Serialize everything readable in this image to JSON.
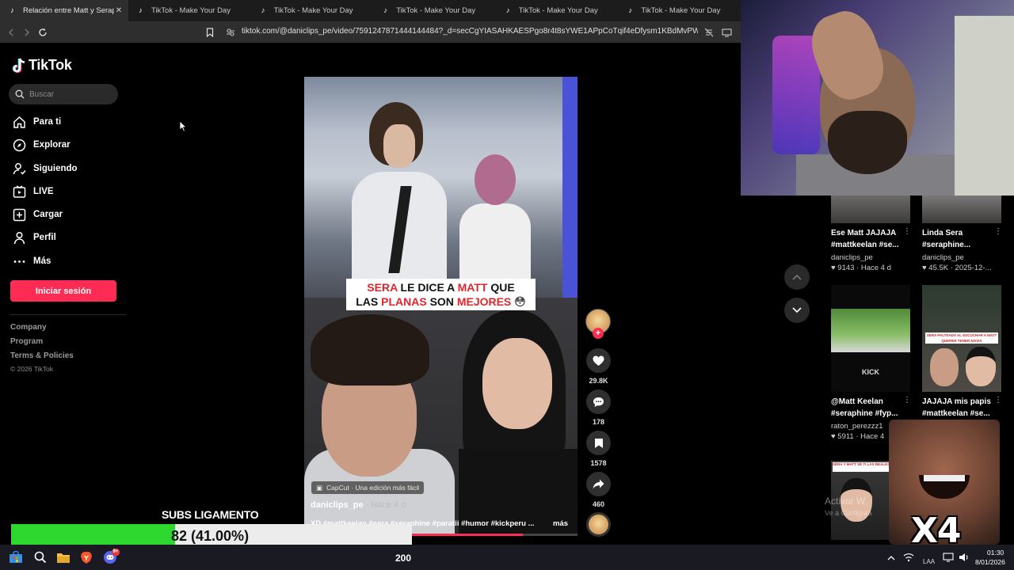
{
  "browser": {
    "tabs": [
      {
        "label": "Relación entre Matt y Seraph",
        "active": true
      },
      {
        "label": "TikTok - Make Your Day",
        "active": false
      },
      {
        "label": "TikTok - Make Your Day",
        "active": false
      },
      {
        "label": "TikTok - Make Your Day",
        "active": false
      },
      {
        "label": "TikTok - Make Your Day",
        "active": false
      },
      {
        "label": "TikTok - Make Your Day",
        "active": false
      }
    ],
    "url": "tiktok.com/@daniclips_pe/video/7591247871444144484?_d=secCgYIASAHKAESPgo8r4t8sYWE1APpCoTqif4eDfysm1KBdMvPWyLx51GZrZu..."
  },
  "sidebar": {
    "logo": "TikTok",
    "search_placeholder": "Buscar",
    "nav": [
      {
        "label": "Para ti",
        "icon": "home-icon"
      },
      {
        "label": "Explorar",
        "icon": "compass-icon"
      },
      {
        "label": "Siguiendo",
        "icon": "following-icon"
      },
      {
        "label": "LIVE",
        "icon": "live-icon"
      },
      {
        "label": "Cargar",
        "icon": "upload-icon"
      },
      {
        "label": "Perfil",
        "icon": "profile-icon"
      },
      {
        "label": "Más",
        "icon": "more-icon"
      }
    ],
    "login_label": "Iniciar sesión",
    "footer_links": [
      "Company",
      "Program",
      "Terms & Policies"
    ],
    "copyright": "© 2026 TikTok"
  },
  "video": {
    "caption": {
      "line1": [
        {
          "t": "SERA",
          "red": true
        },
        {
          "t": " LE DICE A ",
          "red": false
        },
        {
          "t": "MATT",
          "red": true
        },
        {
          "t": " QUE",
          "red": false
        }
      ],
      "line2": [
        {
          "t": "LAS ",
          "red": false
        },
        {
          "t": "PLANAS",
          "red": true
        },
        {
          "t": " SON ",
          "red": false
        },
        {
          "t": "MEJORES",
          "red": true
        },
        {
          "t": " 😳",
          "red": false
        }
      ]
    },
    "capcut_label": "CapCut · Una edición más fácil",
    "author": "daniclips_pe",
    "time": " · Hace 4 d",
    "description": "XD #mattkeelan #sera #seraphine #paratii #humor #kickperu ...",
    "more_label": "más",
    "progress": 0.8
  },
  "actions": {
    "likes": "29.8K",
    "comments": "178",
    "saves": "1578",
    "shares": "460"
  },
  "recommendations": [
    {
      "title": "Ese Matt JAJAJA #mattkeelan #se...",
      "author": "daniclips_pe",
      "stats": "♥ 9143 · Hace 4 d"
    },
    {
      "title": "Linda Sera #seraphine...",
      "author": "daniclips_pe",
      "stats": "♥ 45.5K · 2025-12-..."
    },
    {
      "title": "@Matt Keelan #seraphine #fyp...",
      "author": "raton_perezzz1",
      "stats": "♥ 5911 · Hace 4"
    },
    {
      "title": "JAJAJA mis papis #mattkeelan #se...",
      "author": "",
      "stats": ""
    }
  ],
  "thumb_texts": {
    "kick": "KICK",
    "sera_thumb": "SERA PALTEADA AL ESCUCHAR A MATT QUERER TENER NOVIA",
    "sera_y_matt": "SERA Y MATT SE TI LAS REALES PUERA"
  },
  "windows_watermark": {
    "line1": "Activar W",
    "line2": "Ve a Configura"
  },
  "overlay": {
    "meme_label": "X4",
    "subs_title": "SUBS LIGAMENTO",
    "subs_text": "82 (41.00%)",
    "subs_progress": 0.41
  },
  "taskbar": {
    "center_text": "200",
    "lang": "LAA",
    "time": "01:30",
    "date": "8/01/2026",
    "notif_badge": "9+"
  },
  "colors": {
    "tiktok_red": "#fe2c55",
    "subs_green": "#2fd82f"
  }
}
